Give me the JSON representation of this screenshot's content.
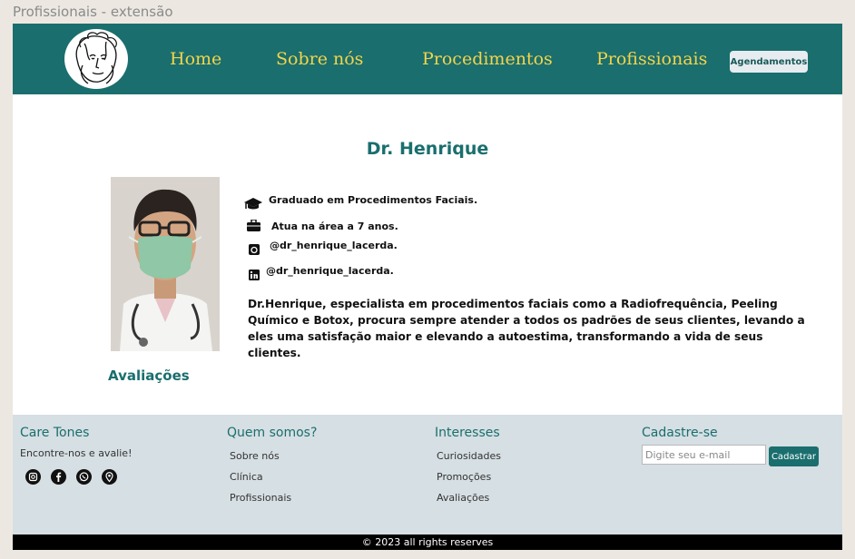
{
  "window": {
    "title": "Profissionais - extensão"
  },
  "header": {
    "nav": [
      "Home",
      "Sobre nós",
      "Procedimentos",
      "Profissionais"
    ],
    "cta_label": "Agendamentos",
    "brand_color": "#1a6e6e",
    "nav_color": "#f3d44a"
  },
  "doctor": {
    "name": "Dr. Henrique",
    "info": [
      {
        "icon": "graduation-cap-icon",
        "text": "Graduado em Procedimentos Faciais."
      },
      {
        "icon": "briefcase-icon",
        "text": "Atua na área a 7 anos."
      },
      {
        "icon": "instagram-icon",
        "text": "@dr_henrique_lacerda."
      },
      {
        "icon": "linkedin-icon",
        "text": "@dr_henrique_lacerda."
      }
    ],
    "bio": "Dr.Henrique, especialista em procedimentos faciais como a Radiofrequência, Peeling Químico e Botox, procura sempre atender a todos os padrões de seus clientes, levando a eles uma satisfação maior e elevando a autoestima, transformando a vida de seus clientes."
  },
  "reviews": {
    "title": "Avaliações"
  },
  "footer": {
    "brand": {
      "title": "Care Tones",
      "tagline": "Encontre-nos e avalie!"
    },
    "social_icons": [
      "instagram-icon",
      "facebook-icon",
      "whatsapp-icon",
      "location-pin-icon"
    ],
    "about": {
      "title": "Quem somos?",
      "links": [
        "Sobre nós",
        "Clínica",
        "Profissionais"
      ]
    },
    "interests": {
      "title": "Interesses",
      "links": [
        "Curiosidades",
        "Promoções",
        "Avaliações"
      ]
    },
    "signup": {
      "title": "Cadastre-se",
      "email_placeholder": "Digite seu e-mail",
      "email_value": "",
      "button_label": "Cadastrar"
    },
    "copyright": "© 2023 all rights reserves"
  }
}
